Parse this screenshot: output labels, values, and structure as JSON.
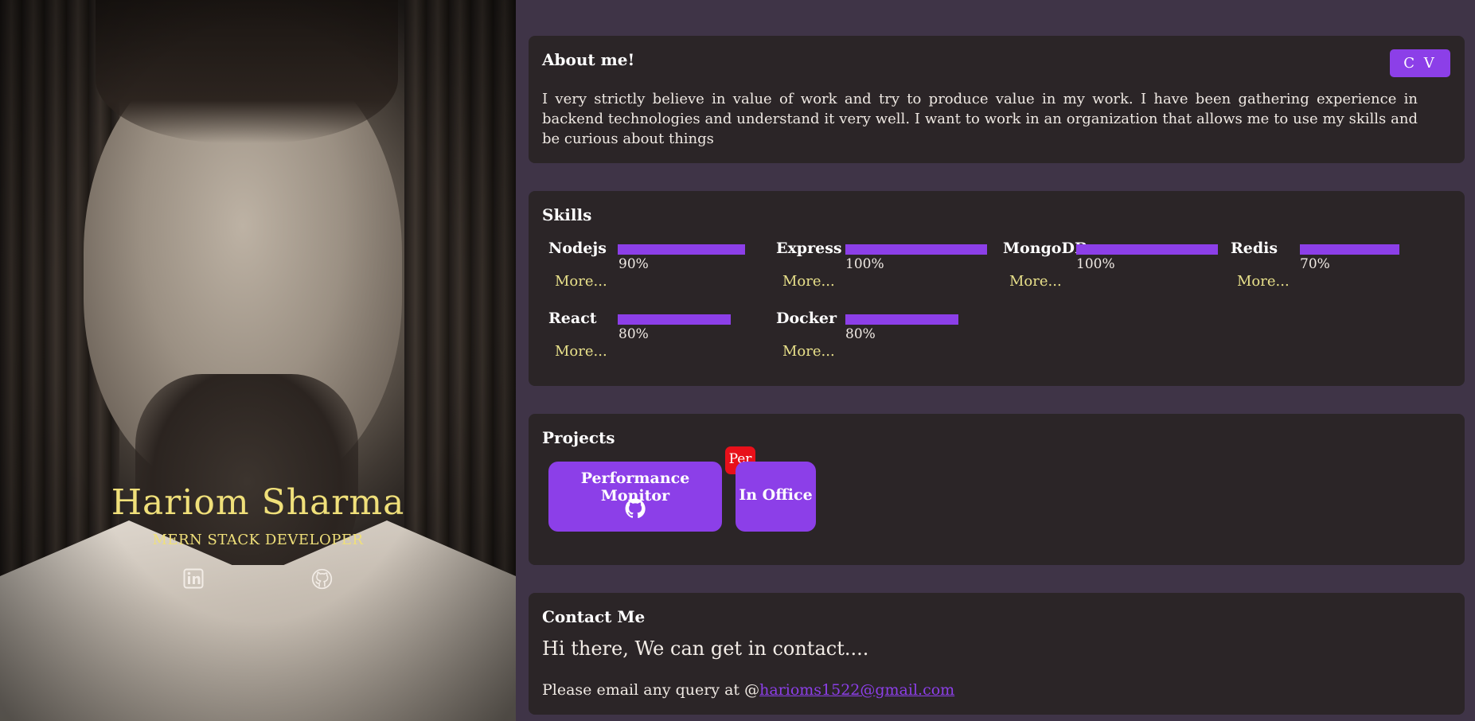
{
  "profile": {
    "name": "Hariom Sharma",
    "role": "MERN STACK DEVELOPER",
    "social": [
      {
        "icon": "linkedin-icon"
      },
      {
        "icon": "github-icon"
      }
    ]
  },
  "about": {
    "title": "About me!",
    "cv_label": "C V",
    "text": "I very strictly believe in value of work and try to produce value in my work. I have been gathering experience in backend technologies and understand it very well. I want to work in an organization that allows me to use my skills and be curious about things"
  },
  "skills": {
    "title": "Skills",
    "items": [
      {
        "name": "Nodejs",
        "value": 0.9,
        "percent": "90%",
        "more": "More..."
      },
      {
        "name": "Express",
        "value": 1.0,
        "percent": "100%",
        "more": "More..."
      },
      {
        "name": "MongoDB",
        "value": 1.0,
        "percent": "100%",
        "more": "More..."
      },
      {
        "name": "Redis",
        "value": 0.7,
        "percent": "70%",
        "more": "More..."
      },
      {
        "name": "React",
        "value": 0.8,
        "percent": "80%",
        "more": "More..."
      },
      {
        "name": "Docker",
        "value": 0.8,
        "percent": "80%",
        "more": "More..."
      }
    ]
  },
  "projects": {
    "title": "Projects",
    "items": [
      {
        "title": "Performance Monitor",
        "badge": "Per",
        "icon": "github-icon"
      },
      {
        "title": "In Office"
      }
    ]
  },
  "contact": {
    "title": "Contact Me",
    "greeting": "Hi there, We can get in contact....",
    "prompt": "Please email any query at @",
    "email": "harioms1522@gmail.com"
  },
  "colors": {
    "accent": "#8c3fe8",
    "highlight": "#f0e07a",
    "background": "#3f3447",
    "card": "#2b2527",
    "badge": "#e8101a"
  }
}
